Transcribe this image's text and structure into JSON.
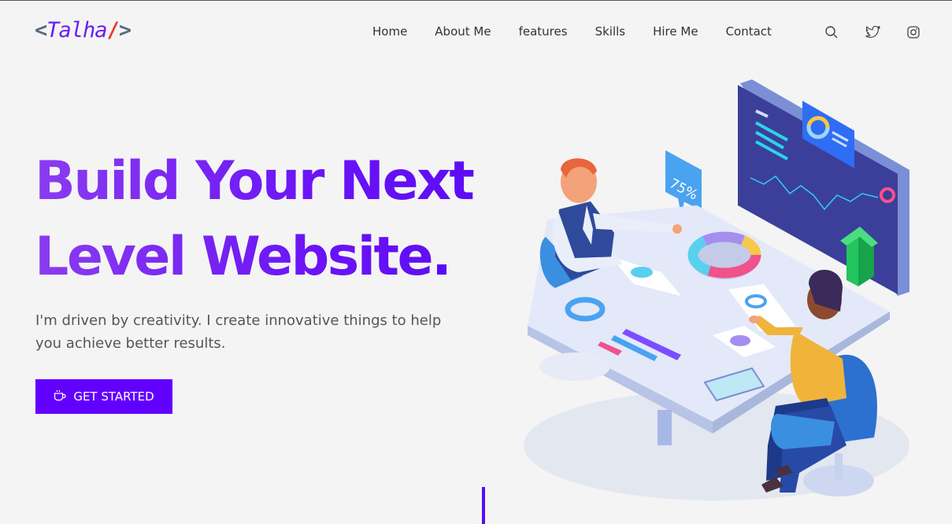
{
  "logo": {
    "open": "<",
    "name": "Talha",
    "slash": "/",
    "close": ">"
  },
  "nav": {
    "items": [
      {
        "label": "Home"
      },
      {
        "label": "About Me"
      },
      {
        "label": "features"
      },
      {
        "label": "Skills"
      },
      {
        "label": "Hire Me"
      },
      {
        "label": "Contact"
      }
    ],
    "icons": [
      "search-icon",
      "twitter-icon",
      "instagram-icon"
    ]
  },
  "hero": {
    "title_line1": "Build Your Next",
    "title_line2": "Level Website",
    "title_dot": ".",
    "subtitle": "I'm driven by creativity. I create innovative things to help you achieve better results.",
    "cta_label": "GET STARTED",
    "cta_icon": "coffee-cup-icon"
  },
  "illustration": {
    "chart_percent": "75%"
  },
  "colors": {
    "accent": "#6200ff",
    "title_gradient_start": "#8b3cf0",
    "text": "#333333"
  }
}
